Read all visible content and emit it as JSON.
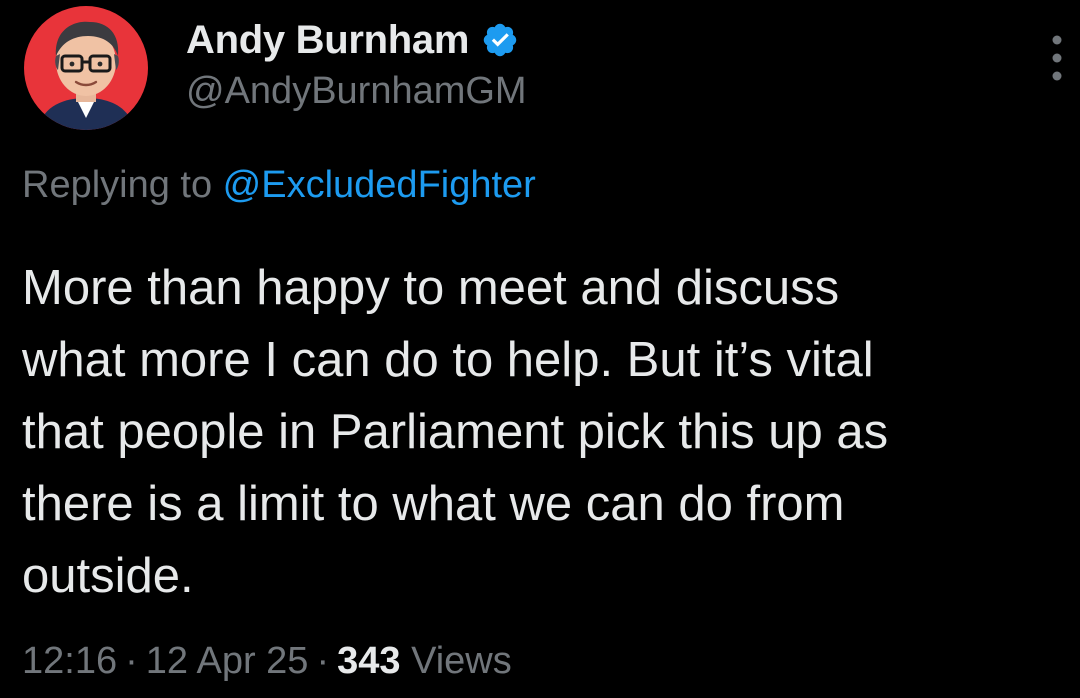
{
  "author": {
    "display_name": "Andy Burnham",
    "handle": "@AndyBurnhamGM",
    "verified_icon": "verified-badge-icon"
  },
  "reply": {
    "prefix": "Replying to ",
    "mention": "@ExcludedFighter"
  },
  "tweet": {
    "lines": [
      "More than happy to meet and discuss",
      "what more I can do to help. But it’s vital",
      "that people in Parliament pick this up as",
      "there is a limit to what we can do from",
      "outside."
    ]
  },
  "meta": {
    "time": "12:16",
    "separator": "·",
    "date": "12 Apr 25",
    "views_count": "343",
    "views_label": "Views"
  },
  "colors": {
    "background": "#000000",
    "primary_text": "#e7e9ea",
    "secondary_text": "#71767b",
    "link": "#1d9bf0",
    "avatar_bg": "#e8343a"
  }
}
